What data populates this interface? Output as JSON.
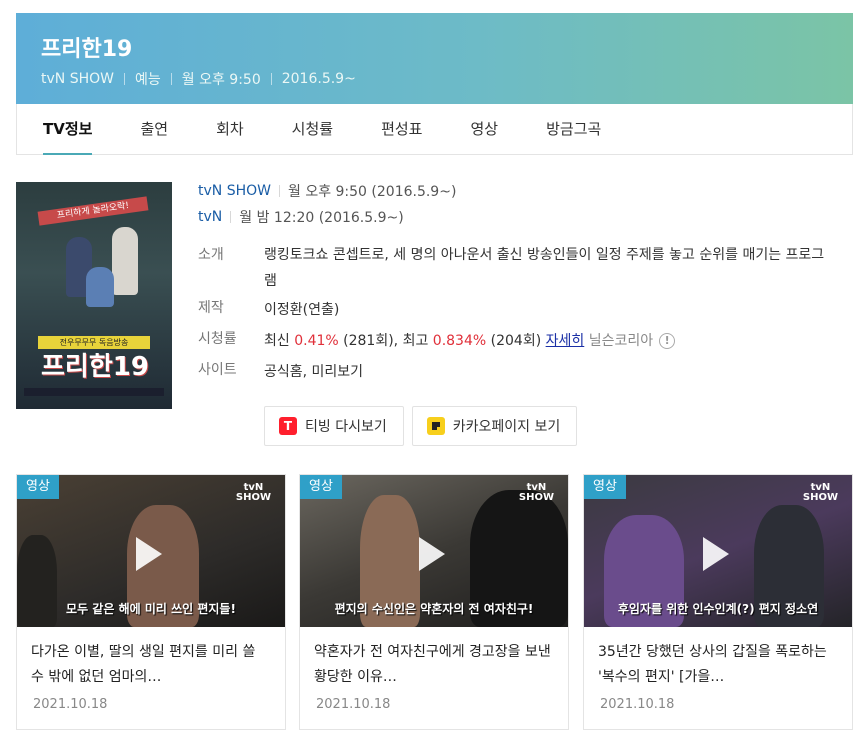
{
  "header": {
    "title": "프리한19",
    "meta": [
      "tvN SHOW",
      "예능",
      "월 오후 9:50",
      "2016.5.9~"
    ]
  },
  "tabs": [
    {
      "label": "TV정보",
      "active": true
    },
    {
      "label": "출연"
    },
    {
      "label": "회차"
    },
    {
      "label": "시청률"
    },
    {
      "label": "편성표"
    },
    {
      "label": "영상"
    },
    {
      "label": "방금그곡"
    }
  ],
  "poster": {
    "banner": "프리하게 놀라오락!",
    "tag": "전우무무무 독음방송",
    "logo": "프리한19"
  },
  "broadcast": [
    {
      "channel": "tvN SHOW",
      "time": "월 오후 9:50 (2016.5.9~)"
    },
    {
      "channel": "tvN",
      "time": "월 밤 12:20 (2016.5.9~)"
    }
  ],
  "info": {
    "desc_label": "소개",
    "desc": "랭킹토크쇼 콘셉트로, 세 명의 아나운서 출신 방송인들이 일정 주제를 놓고 순위를 매기는 프로그램",
    "prod_label": "제작",
    "prod": "이정환(연출)",
    "rating_label": "시청률",
    "rating_latest_prefix": "최신 ",
    "rating_latest_value": "0.41%",
    "rating_latest_ep": " (281회), 최고 ",
    "rating_max_value": "0.834%",
    "rating_max_ep": " (204회) ",
    "rating_detail": "자세히",
    "rating_source": " 닐슨코리아",
    "site_label": "사이트",
    "site_links": "공식홈, 미리보기"
  },
  "buttons": {
    "tving": "티빙 다시보기",
    "tving_icon": "T",
    "kakao": "카카오페이지 보기"
  },
  "videos": [
    {
      "badge": "영상",
      "caption": "모두 같은 해에 미리 쓰인 편지들!",
      "title": "다가온 이별, 딸의 생일 편지를 미리 쓸 수 밖에 없던 엄마의…",
      "date": "2021.10.18"
    },
    {
      "badge": "영상",
      "caption": "편지의 수신인은 약혼자의 전 여자친구!",
      "title": "약혼자가 전 여자친구에게 경고장을 보낸 황당한 이유…",
      "date": "2021.10.18"
    },
    {
      "badge": "영상",
      "caption": "후임자를 위한 인수인계(?) 편지 정소연",
      "title": "35년간 당했던 상사의 갑질을 폭로하는 '복수의 편지' [가을…",
      "date": "2021.10.18"
    }
  ],
  "tvn_logo": "tvN\nSHOW"
}
